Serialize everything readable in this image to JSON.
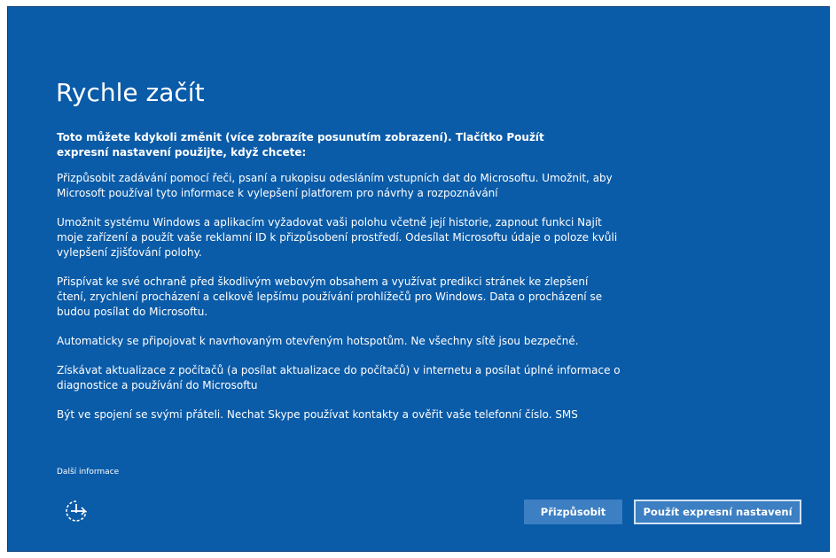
{
  "page": {
    "title": "Rychle začít",
    "intro": "Toto můžete kdykoli změnit (více zobrazíte posunutím zobrazení). Tlačítko Použít expresní nastavení použijte, když chcete:",
    "paragraphs": [
      "Přizpůsobit zadávání pomocí řeči, psaní a rukopisu odesláním vstupních dat do Microsoftu. Umožnit, aby Microsoft používal tyto informace k vylepšení platforem pro návrhy a rozpoznávání",
      "Umožnit systému Windows a aplikacím vyžadovat vaši polohu včetně její historie, zapnout funkci Najít moje zařízení a použít vaše reklamní ID k přizpůsobení prostředí. Odesílat Microsoftu údaje o poloze kvůli vylepšení zjišťování polohy.",
      "Přispívat ke své ochraně před škodlivým webovým obsahem a využívat predikci stránek ke zlepšení čtení, zrychlení procházení a celkově lepšímu používání prohlížečů pro Windows. Data o procházení se budou posílat do Microsoftu.",
      "Automaticky se připojovat k navrhovaným otevřeným hotspotům. Ne všechny sítě jsou bezpečné.",
      "Získávat aktualizace z počítačů (a posílat aktualizace do počítačů) v internetu a posílat úplné informace o diagnostice a používání do Microsoftu",
      "Být ve spojení se svými přáteli. Nechat Skype používat kontakty a ověřit vaše telefonní číslo. SMS"
    ],
    "more_info_link": "Další informace",
    "ease_of_access_icon": "ease-of-access-icon"
  },
  "buttons": {
    "customize": "Přizpůsobit",
    "express": "Použít expresní nastavení"
  },
  "colors": {
    "background": "#0a5ba8",
    "button": "#3c7fc2",
    "text": "#ffffff"
  }
}
